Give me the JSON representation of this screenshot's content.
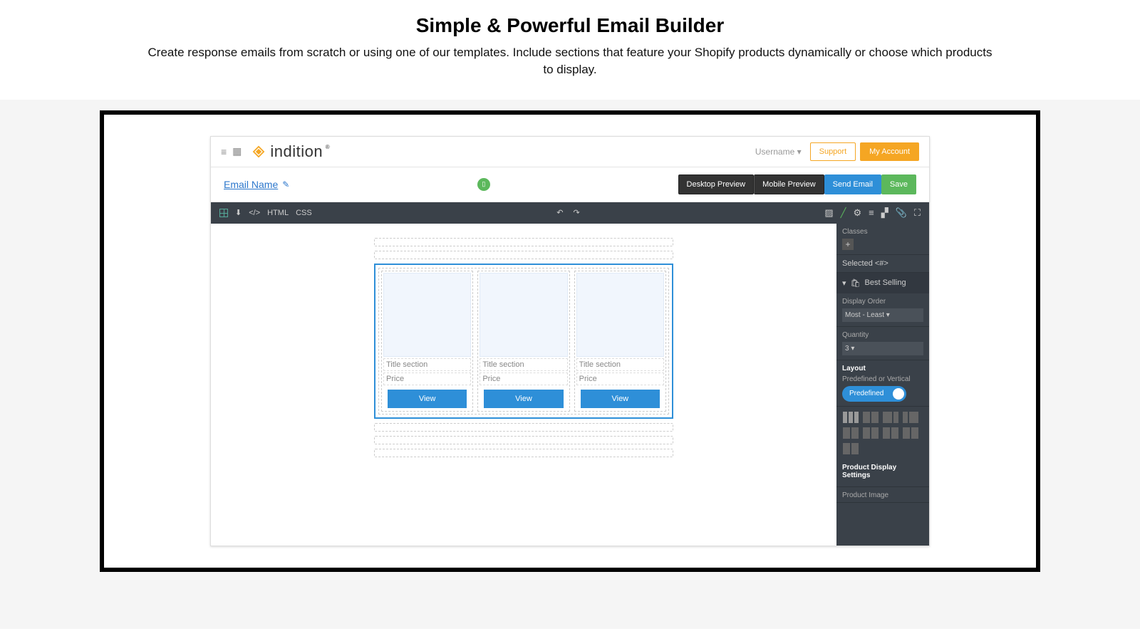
{
  "hero": {
    "title": "Simple & Powerful Email Builder",
    "subtitle": "Create response emails from scratch or using one of our templates. Include sections that feature your Shopify products dynamically or choose which products to display."
  },
  "topbar": {
    "brand": "indition",
    "username": "Username ▾",
    "support": "Support",
    "account": "My Account"
  },
  "bar2": {
    "email_name": "Email Name",
    "desktop_preview": "Desktop Preview",
    "mobile_preview": "Mobile Preview",
    "send_email": "Send Email",
    "save": "Save"
  },
  "strip": {
    "html": "HTML",
    "css": "CSS"
  },
  "card": {
    "title": "Title section",
    "price": "Price",
    "view": "View"
  },
  "panel": {
    "classes": "Classes",
    "selected": "Selected <#>",
    "best_selling": "Best Selling",
    "display_order_label": "Display Order",
    "display_order": "Most - Least",
    "quantity_label": "Quantity",
    "quantity": "3",
    "layout": "Layout",
    "predef_label": "Predefined or Vertical",
    "predefined": "Predefined",
    "pds": "Product Display Settings",
    "product_image": "Product Image"
  }
}
